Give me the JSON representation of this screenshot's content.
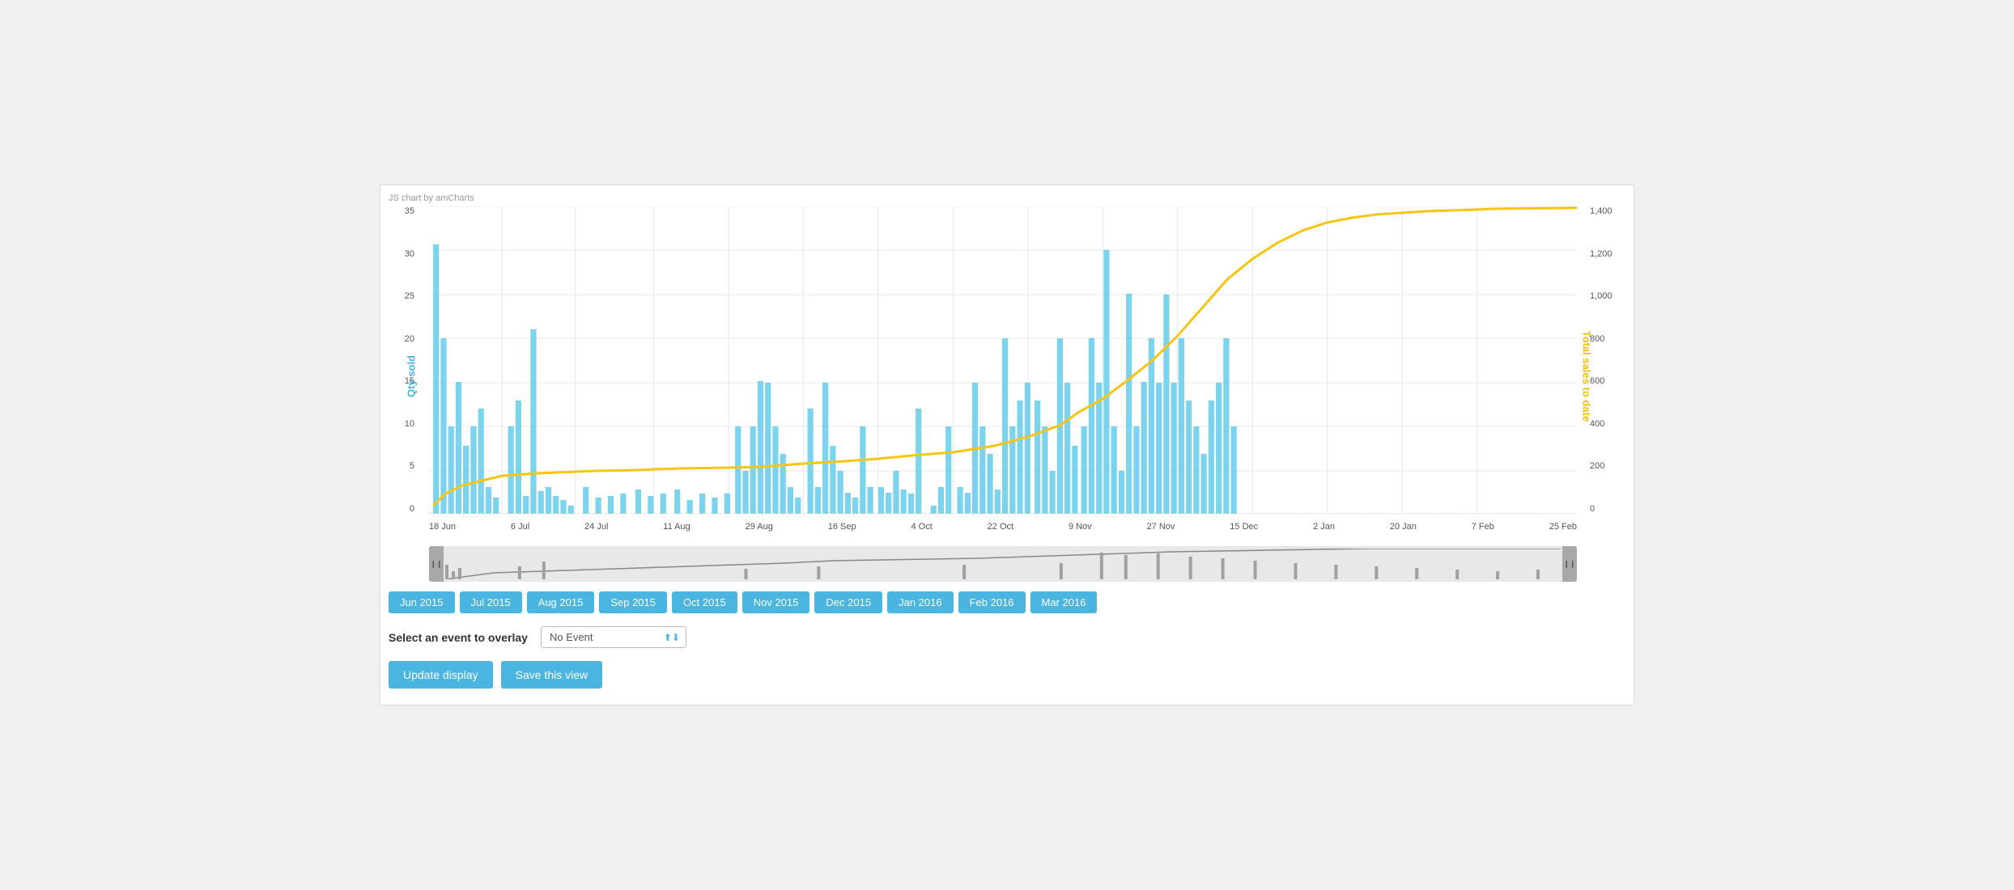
{
  "chart": {
    "credit": "JS chart by amCharts",
    "y_left_title": "Qty sold",
    "y_right_title": "Total sales to date",
    "y_left_labels": [
      "35",
      "30",
      "25",
      "20",
      "15",
      "10",
      "5",
      "0"
    ],
    "y_right_labels": [
      "1,400",
      "1,200",
      "1,000",
      "800",
      "600",
      "400",
      "200",
      "0"
    ],
    "x_labels": [
      "18 Jun",
      "6 Jul",
      "24 Jul",
      "11 Aug",
      "29 Aug",
      "16 Sep",
      "4 Oct",
      "22 Oct",
      "9 Nov",
      "27 Nov",
      "15 Dec",
      "2 Jan",
      "20 Jan",
      "7 Feb",
      "25 Feb"
    ]
  },
  "months": [
    "Jun 2015",
    "Jul 2015",
    "Aug 2015",
    "Sep 2015",
    "Oct 2015",
    "Nov 2015",
    "Dec 2015",
    "Jan 2016",
    "Feb 2016",
    "Mar 2016"
  ],
  "event_overlay": {
    "label": "Select an event to overlay",
    "placeholder": "No Event",
    "options": [
      "No Event"
    ]
  },
  "buttons": {
    "update": "Update display",
    "save": "Save this view"
  },
  "icons": {
    "scroll_left": "❙❙",
    "scroll_right": "❙❙",
    "select_arrows": "⬆⬇"
  }
}
